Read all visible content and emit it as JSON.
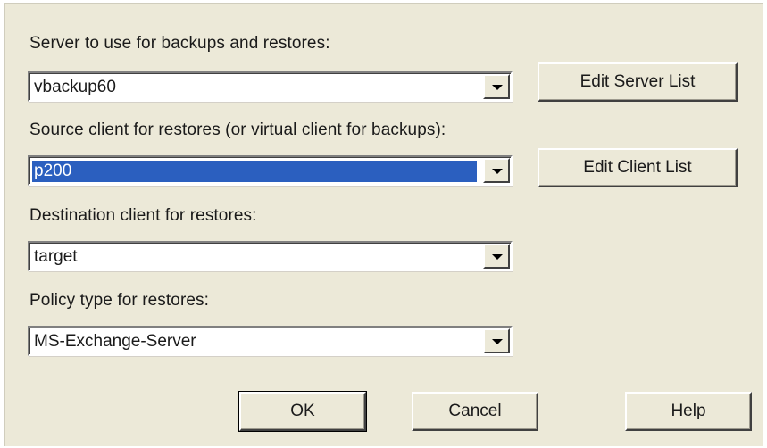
{
  "server": {
    "label": "Server to use for backups and restores:",
    "value": "vbackup60",
    "edit_button": "Edit Server List"
  },
  "source_client": {
    "label": "Source client for restores (or virtual client for backups):",
    "value": "p200",
    "edit_button": "Edit Client List"
  },
  "destination_client": {
    "label": "Destination client for restores:",
    "value": "target"
  },
  "policy_type": {
    "label": "Policy type for restores:",
    "value": "MS-Exchange-Server"
  },
  "buttons": {
    "ok": "OK",
    "cancel": "Cancel",
    "help": "Help"
  },
  "colors": {
    "dialog_background": "#ece9d8",
    "selection_highlight": "#2b5fbf"
  },
  "icons": {
    "dropdown": "chevron-down-icon"
  }
}
